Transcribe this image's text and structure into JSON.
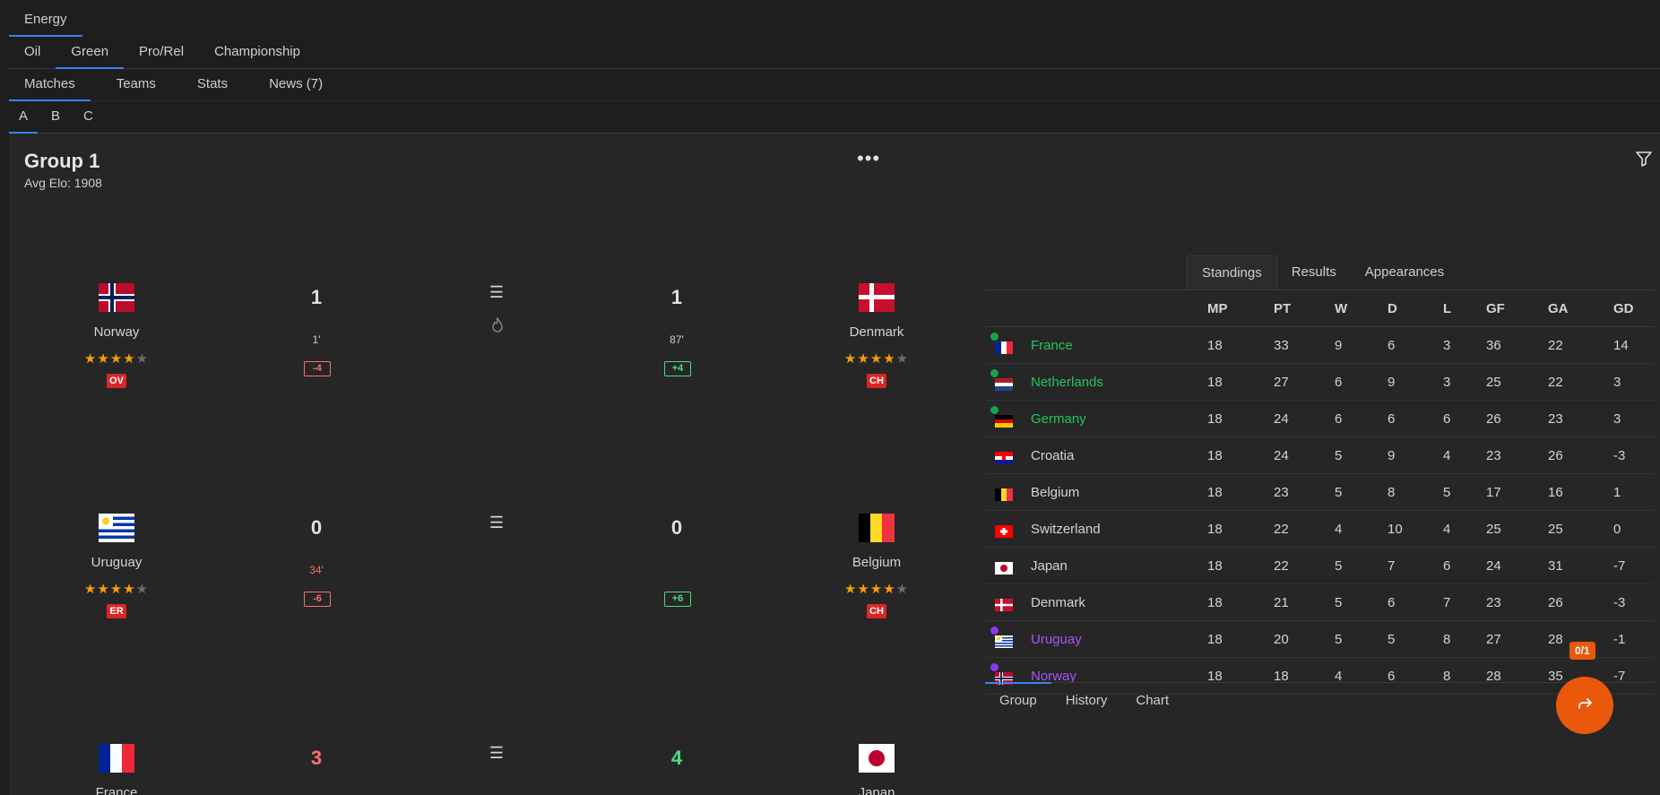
{
  "nav": {
    "row1": [
      "Energy"
    ],
    "row2": [
      "Oil",
      "Green",
      "Pro/Rel",
      "Championship"
    ],
    "row3": [
      "Matches",
      "Teams",
      "Stats",
      "News (7)"
    ],
    "row4": [
      "A",
      "B",
      "C"
    ],
    "active": {
      "row1": "Energy",
      "row2": "Green",
      "row3": "Matches",
      "row4": "A"
    }
  },
  "group": {
    "title": "Group 1",
    "avg_elo": "Avg Elo: 1908"
  },
  "matches": [
    {
      "home": {
        "name": "Norway",
        "flag": "norway-flag",
        "stars": 4,
        "badge": "OV"
      },
      "away": {
        "name": "Denmark",
        "flag": "denmark-flag",
        "stars": 4,
        "badge": "CH"
      },
      "home_score": "1",
      "away_score": "1",
      "home_minute": "1'",
      "away_minute": "87'",
      "home_delta": "-4",
      "away_delta": "+4",
      "fire_icon": true
    },
    {
      "home": {
        "name": "Uruguay",
        "flag": "uruguay-flag",
        "stars": 4,
        "badge": "ER"
      },
      "away": {
        "name": "Belgium",
        "flag": "belgium-flag",
        "stars": 4,
        "badge": "CH"
      },
      "home_score": "0",
      "away_score": "0",
      "home_minute": "34'",
      "away_minute": "",
      "home_delta": "-6",
      "away_delta": "+6",
      "fire_icon": false
    },
    {
      "home": {
        "name": "France",
        "flag": "france-flag"
      },
      "away": {
        "name": "Japan",
        "flag": "japan-flag"
      },
      "home_score": "3",
      "away_score": "4",
      "home_score_color": "#f87171",
      "away_score_color": "#4ade80"
    }
  ],
  "standings_tabs": [
    "Standings",
    "Results",
    "Appearances"
  ],
  "standings_active": "Standings",
  "standings": {
    "columns": [
      "MP",
      "PT",
      "W",
      "D",
      "L",
      "GF",
      "GA",
      "GD"
    ],
    "rows": [
      {
        "team": "France",
        "flag": "france-flag",
        "status": "green",
        "MP": "18",
        "PT": "33",
        "W": "9",
        "D": "6",
        "L": "3",
        "GF": "36",
        "GA": "22",
        "GD": "14"
      },
      {
        "team": "Netherlands",
        "flag": "netherlands-flag",
        "status": "green",
        "MP": "18",
        "PT": "27",
        "W": "6",
        "D": "9",
        "L": "3",
        "GF": "25",
        "GA": "22",
        "GD": "3"
      },
      {
        "team": "Germany",
        "flag": "germany-flag",
        "status": "green",
        "MP": "18",
        "PT": "24",
        "W": "6",
        "D": "6",
        "L": "6",
        "GF": "26",
        "GA": "23",
        "GD": "3"
      },
      {
        "team": "Croatia",
        "flag": "croatia-flag",
        "status": "",
        "MP": "18",
        "PT": "24",
        "W": "5",
        "D": "9",
        "L": "4",
        "GF": "23",
        "GA": "26",
        "GD": "-3"
      },
      {
        "team": "Belgium",
        "flag": "belgium-flag",
        "status": "",
        "MP": "18",
        "PT": "23",
        "W": "5",
        "D": "8",
        "L": "5",
        "GF": "17",
        "GA": "16",
        "GD": "1"
      },
      {
        "team": "Switzerland",
        "flag": "switzerland-flag",
        "status": "",
        "MP": "18",
        "PT": "22",
        "W": "4",
        "D": "10",
        "L": "4",
        "GF": "25",
        "GA": "25",
        "GD": "0"
      },
      {
        "team": "Japan",
        "flag": "japan-flag",
        "status": "",
        "MP": "18",
        "PT": "22",
        "W": "5",
        "D": "7",
        "L": "6",
        "GF": "24",
        "GA": "31",
        "GD": "-7"
      },
      {
        "team": "Denmark",
        "flag": "denmark-flag",
        "status": "",
        "MP": "18",
        "PT": "21",
        "W": "5",
        "D": "6",
        "L": "7",
        "GF": "23",
        "GA": "26",
        "GD": "-3"
      },
      {
        "team": "Uruguay",
        "flag": "uruguay-flag",
        "status": "purple",
        "MP": "18",
        "PT": "20",
        "W": "5",
        "D": "5",
        "L": "8",
        "GF": "27",
        "GA": "28",
        "GD": "-1"
      },
      {
        "team": "Norway",
        "flag": "norway-flag",
        "status": "purple",
        "MP": "18",
        "PT": "18",
        "W": "4",
        "D": "6",
        "L": "8",
        "GF": "28",
        "GA": "35",
        "GD": "-7"
      }
    ]
  },
  "bottom_tabs": [
    "Group",
    "History",
    "Chart"
  ],
  "bottom_active": "Group",
  "counter": "0/1",
  "colors": {
    "accent": "#3b82f6",
    "fab": "#ea580c",
    "qualify": "#22c55e",
    "relegate": "#a855f7"
  }
}
